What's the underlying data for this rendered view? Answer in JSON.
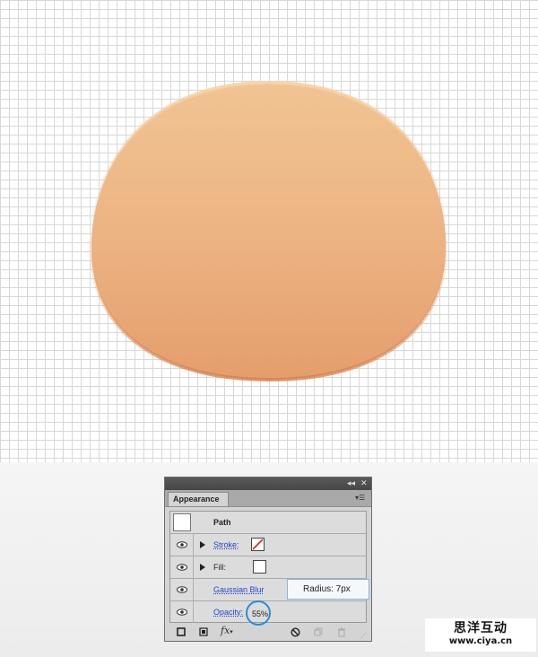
{
  "canvas": {
    "shape": "orange-rounded-blob",
    "colors": {
      "light": "#f1c493",
      "mid": "#ecb282",
      "dark": "#dd8e5e",
      "grid": "#d8d8d8"
    }
  },
  "panel": {
    "tab_label": "Appearance",
    "collapse_icon": "double-chevron-icon",
    "close_icon": "close-icon",
    "menu_icon": "panel-menu-icon",
    "rows": {
      "path_label": "Path",
      "stroke_label": "Stroke:",
      "fill_label": "Fill:",
      "effect_label": "Gaussian Blur",
      "opacity_label": "Opacity:",
      "opacity_value": "55%"
    },
    "tooltip": "Radius: 7px",
    "toolbar_icons": [
      "add-stroke-icon",
      "add-fill-icon",
      "fx-icon",
      "clear-appearance-icon",
      "duplicate-item-icon",
      "delete-item-icon"
    ],
    "fx_label": "fx"
  },
  "watermark": {
    "title": "思洋互动",
    "url": "www.ciya.cn"
  }
}
